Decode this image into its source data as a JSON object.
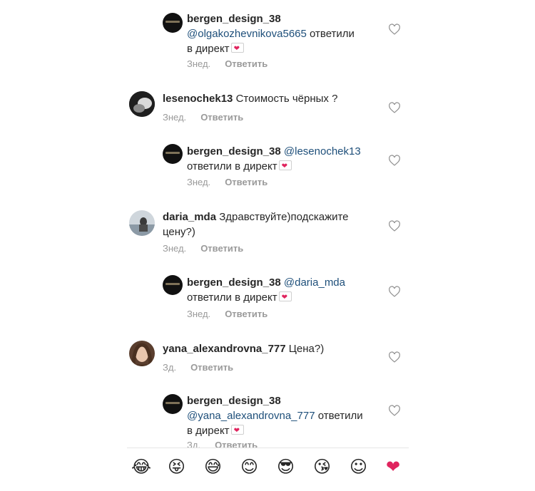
{
  "comments": [
    {
      "username": "bergen_design_38",
      "mention": "@olgakozhevnikova5665",
      "text_after_mention_line1": "ответили",
      "text_line2": "в директ",
      "time": "Знед.",
      "reply_label": "Ответить"
    },
    {
      "username": "lesenochek13",
      "text": "Стоимость чёрных ?",
      "time": "Знед.",
      "reply_label": "Ответить"
    },
    {
      "username": "bergen_design_38",
      "mention": "@lesenochek13",
      "text_line2": "ответили в директ",
      "time": "Знед.",
      "reply_label": "Ответить"
    },
    {
      "username": "daria_mda",
      "text_line1": "Здравствуйте)подскажите",
      "text_line2": "цену?)",
      "time": "Знед.",
      "reply_label": "Ответить"
    },
    {
      "username": "bergen_design_38",
      "mention": "@daria_mda",
      "text_line2": "ответили в директ",
      "time": "Знед.",
      "reply_label": "Ответить"
    },
    {
      "username": "yana_alexandrovna_777",
      "text": "Цена?)",
      "time": "Зд.",
      "reply_label": "Ответить"
    },
    {
      "username": "bergen_design_38",
      "mention": "@yana_alexandrovna_777",
      "text_after_mention_line1": "ответили",
      "text_line2": "в директ",
      "time": "Зд.",
      "reply_label": "Ответить"
    }
  ],
  "emoji_bar": [
    "😂",
    "😝",
    "😅",
    "😊",
    "😎",
    "😘",
    "☺",
    "❤"
  ],
  "colors": {
    "mention": "#1e4f7a",
    "meta": "#9a9a9a",
    "heart": "#e0245e"
  },
  "icons": {
    "like": "heart-outline-icon",
    "direct_message": "heart-envelope-icon"
  }
}
